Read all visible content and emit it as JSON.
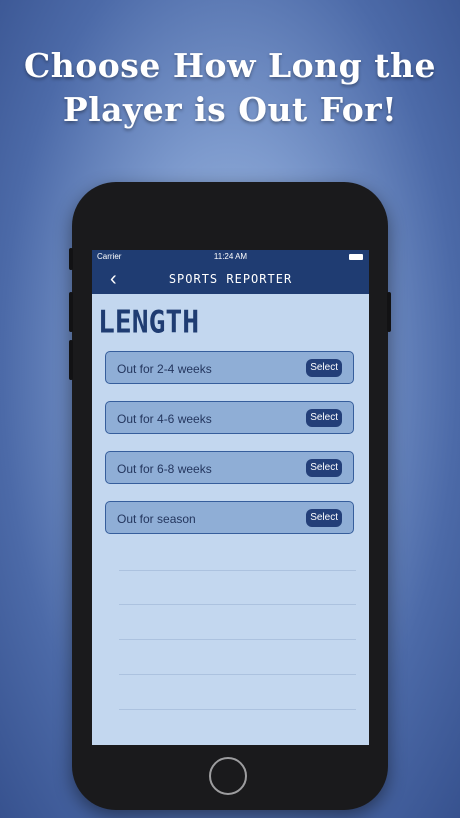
{
  "headline": {
    "line1": "Choose How Long the",
    "line2": "Player is Out For!"
  },
  "statusbar": {
    "carrier": "Carrier",
    "time": "11:24 AM"
  },
  "navbar": {
    "back_icon": "‹",
    "title": "SPORTS REPORTER"
  },
  "page": {
    "title": "LENGTH"
  },
  "options": [
    {
      "label": "Out for 2-4 weeks",
      "button": "Select"
    },
    {
      "label": "Out for 4-6 weeks",
      "button": "Select"
    },
    {
      "label": "Out for 6-8 weeks",
      "button": "Select"
    },
    {
      "label": "Out for season",
      "button": "Select"
    }
  ],
  "colors": {
    "nav_bar": "#1f3c72",
    "screen_bg": "#c3d7ef",
    "option_bg": "#8faed6",
    "button_bg": "#233f79"
  }
}
